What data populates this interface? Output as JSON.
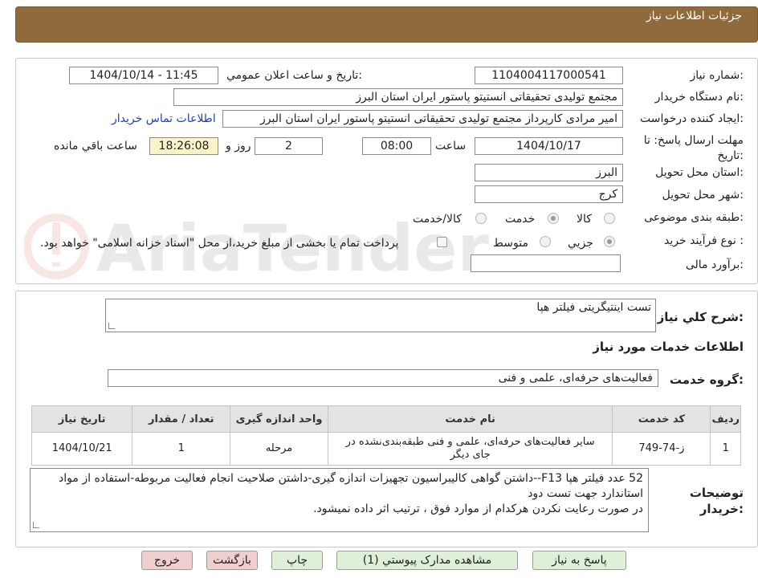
{
  "header": {
    "title": "جزئیات اطلاعات نیاز"
  },
  "need_number": {
    "label": "شماره نیاز:",
    "value": "1104004117000541"
  },
  "announce": {
    "label": "تاريخ و ساعت اعلان عمومي:",
    "value": "1404/10/14 - 11:45"
  },
  "buyer_org": {
    "label": "نام دستگاه خریدار:",
    "value": "مجتمع تولیدی تحقیقاتی انستیتو پاستور ایران استان البرز"
  },
  "requester": {
    "label": "ایجاد کننده درخواست:",
    "value": "امیر مرادی کارپرداز مجتمع تولیدی تحقیقاتی انستیتو پاستور ایران استان البرز",
    "contact_link": "اطلاعات تماس خریدار"
  },
  "deadline": {
    "label": "مهلت ارسال پاسخ: تا تاریخ:",
    "date": "1404/10/17",
    "time_label": "ساعت",
    "time": "08:00",
    "days": "2",
    "days_label": "روز و",
    "remaining": "18:26:08",
    "remaining_label": "ساعت باقي مانده"
  },
  "province": {
    "label": "استان محل تحویل:",
    "value": "البرز"
  },
  "city": {
    "label": "شهر محل تحویل:",
    "value": "کرج"
  },
  "category": {
    "label": "طبقه بندی موضوعی:",
    "options": [
      "کالا",
      "خدمت",
      "کالا/خدمت"
    ],
    "selected": "خدمت"
  },
  "purchase_process": {
    "label": "نوع فرآیند خرید :",
    "options": [
      "جزیي",
      "متوسط"
    ],
    "selected": "جزیي",
    "note": "پرداخت تمام یا بخشی از مبلغ خرید،از محل \"اسناد خزانه اسلامی\" خواهد بود."
  },
  "estimate": {
    "label": "برآورد مالی:",
    "value": ""
  },
  "summary": {
    "label": "شرح کلي نياز:",
    "value": "تست اینتیگریتی فیلتر هپا"
  },
  "services_info": {
    "title": "اطلاعات خدمات مورد نیاز"
  },
  "service_group": {
    "label": "گروه خدمت:",
    "value": "فعالیت‌های حرفه‌ای، علمی و فنی"
  },
  "table": {
    "headers": [
      "ردیف",
      "کد خدمت",
      "نام خدمت",
      "واحد اندازه گیری",
      "تعداد / مقدار",
      "تاریخ نیاز"
    ],
    "rows": [
      [
        "1",
        "ز-74-749",
        "سایر فعالیت‌های حرفه‌ای، علمی و فنی طبقه‌بندی‌نشده در جای دیگر",
        "مرحله",
        "1",
        "1404/10/21"
      ]
    ]
  },
  "buyer_notes": {
    "label": "توضیحات خریدار:",
    "lines": [
      "52 عدد فیلتر هپا F13--داشتن گواهی کالیبراسیون تجهیزات اندازه گیری-داشتن صلاحیت انجام فعالیت مربوطه-استفاده از مواد استاندارد جهت تست دود",
      "در صورت رعایت نکردن هرکدام از موارد فوق ، ترتیب اثر داده نمیشود."
    ]
  },
  "buttons": {
    "reply": "پاسخ به نیاز",
    "attachments": "مشاهده مدارک پیوستي (1)",
    "print": "چاپ",
    "back": "بازگشت",
    "exit": "خروج"
  },
  "watermark": {
    "text": "AriaTender.net"
  },
  "colors": {
    "header_bg": "#8f6a3d",
    "button_green": "#dff0d8",
    "button_red": "#f2cfcf",
    "link": "#1a3fbf"
  }
}
